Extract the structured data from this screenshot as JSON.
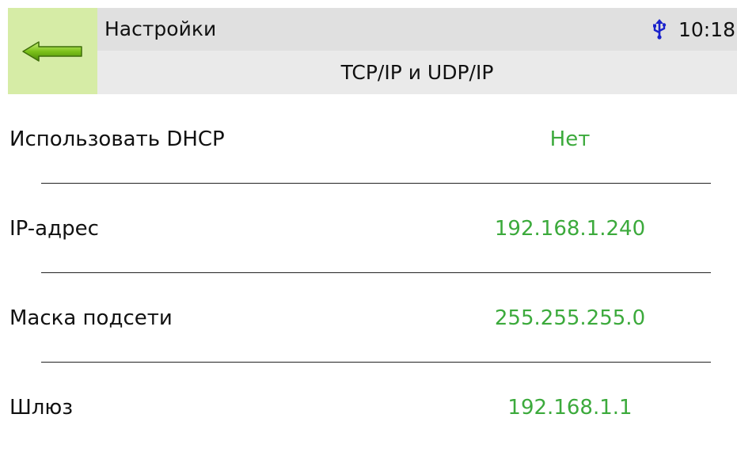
{
  "header": {
    "title": "Настройки",
    "subtitle": "TCP/IP и UDP/IP",
    "clock": "10:18",
    "back_icon": "arrow-left-icon",
    "status_icon": "usb-icon"
  },
  "colors": {
    "back_button_bg": "#d6eca6",
    "value_green": "#3caa3c",
    "title_bar_bg": "#e0e0e0",
    "usb_blue": "#1a22cc"
  },
  "settings": [
    {
      "label": "Использовать DHCP",
      "value": "Нет"
    },
    {
      "label": "IP-адрес",
      "value": "192.168.1.240"
    },
    {
      "label": "Маска подсети",
      "value": "255.255.255.0"
    },
    {
      "label": "Шлюз",
      "value": "192.168.1.1"
    }
  ]
}
